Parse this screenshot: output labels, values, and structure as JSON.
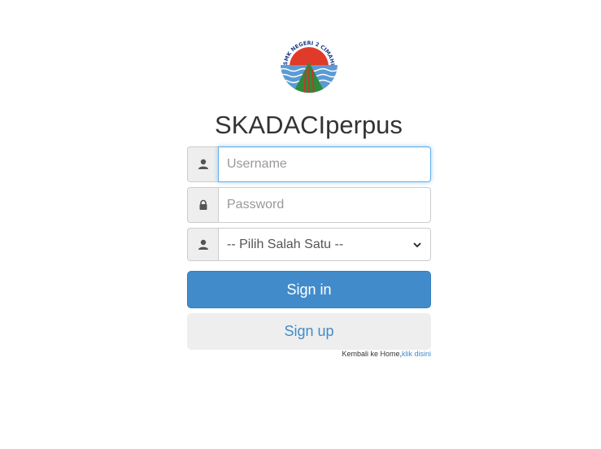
{
  "logo": {
    "text": "SMK NEGERI 2 CIMAHI",
    "colors": {
      "sun": "#e03a2a",
      "water": "#5b9bd5",
      "mountain": "#2e8b3a",
      "stripes": "#c0392b"
    }
  },
  "app_title": "SKADACIperpus",
  "login_form": {
    "username_placeholder": "Username",
    "password_placeholder": "Password",
    "role_select_value": "-- Pilih Salah Satu --",
    "signin_label": "Sign in",
    "signup_label": "Sign up",
    "back_text": "Kembali ke Home,",
    "back_link": "klik disini"
  },
  "icons": {
    "username": "user-icon",
    "password": "lock-icon",
    "role": "user-icon",
    "select": "chevron-down-icon"
  },
  "colors": {
    "primary": "#428bca",
    "focus": "#66afe9",
    "addon_bg": "#eeeeee",
    "text": "#333333"
  }
}
